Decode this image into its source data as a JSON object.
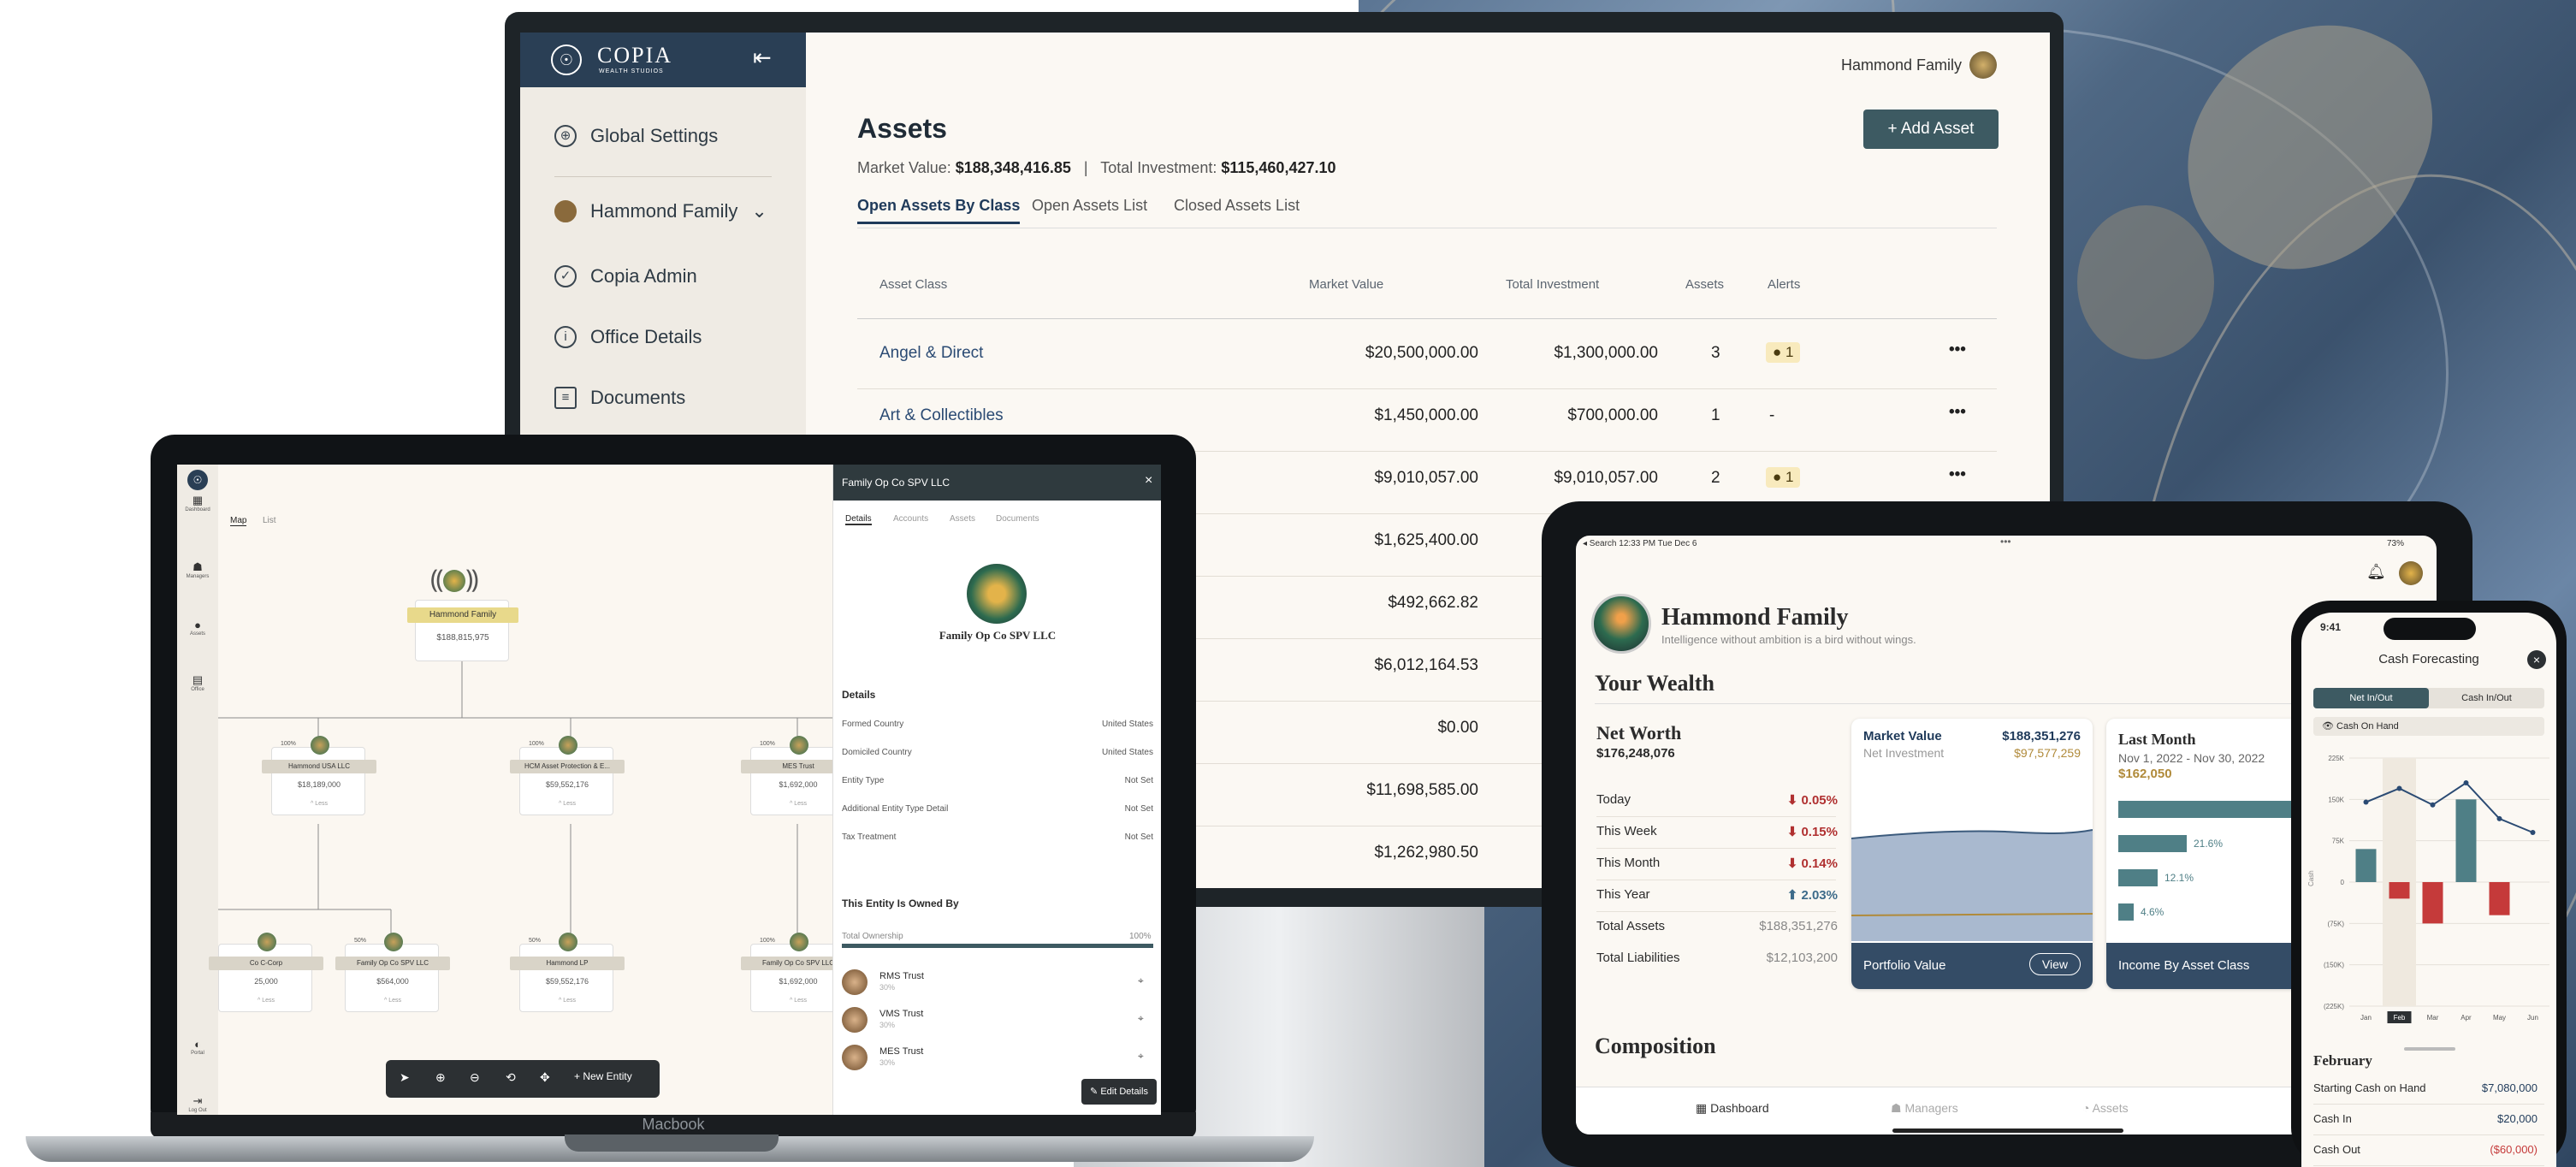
{
  "monitor": {
    "brand": "COPIA",
    "brand_sub": "WEALTH STUDIOS",
    "account_label": "Hammond Family",
    "nav": [
      "Global Settings",
      "Hammond Family",
      "Copia Admin",
      "Office Details",
      "Documents"
    ],
    "title": "Assets",
    "add_button": "+ Add Asset",
    "market_value_label": "Market Value:",
    "market_value": "$188,348,416.85",
    "separator": "|",
    "total_investment_label": "Total Investment:",
    "total_investment": "$115,460,427.10",
    "tabs": [
      "Open Assets By Class",
      "Open Assets List",
      "Closed Assets List"
    ],
    "columns": [
      "Asset Class",
      "Market Value",
      "Total Investment",
      "Assets",
      "Alerts"
    ],
    "rows": [
      {
        "name": "Angel & Direct",
        "mv": "$20,500,000.00",
        "ti": "$1,300,000.00",
        "count": "3",
        "alert": "1"
      },
      {
        "name": "Art & Collectibles",
        "mv": "$1,450,000.00",
        "ti": "$700,000.00",
        "count": "1",
        "alert": "-"
      },
      {
        "name": "",
        "mv": "$9,010,057.00",
        "ti": "$9,010,057.00",
        "count": "2",
        "alert": "1"
      },
      {
        "name": "",
        "mv": "$1,625,400.00",
        "ti": "$1,11"
      },
      {
        "name": "",
        "mv": "$492,662.82",
        "ti": "$"
      },
      {
        "name": "",
        "mv": "$6,012,164.53",
        "ti": "$2,30"
      },
      {
        "name": "",
        "mv": "$0.00",
        "ti": "$"
      },
      {
        "name": "",
        "mv": "$11,698,585.00",
        "ti": "$10,00"
      },
      {
        "name": "",
        "mv": "$1,262,980.50",
        "ti": "$1,03"
      }
    ],
    "more": "•••"
  },
  "laptop": {
    "brand_label": "Macbook",
    "sidebar": [
      "Dashboard",
      "Managers",
      "Assets",
      "Office",
      "Portal",
      "Log Out"
    ],
    "view_tabs": [
      "Map",
      "List"
    ],
    "root_name": "Hammond Family",
    "root_value": "$188,815,975",
    "nodes": [
      {
        "pct": "100%",
        "name": "Hammond USA LLC",
        "value": "$18,189,000"
      },
      {
        "pct": "100%",
        "name": "HCM Asset Protection & E...",
        "value": "$59,552,176"
      },
      {
        "pct": "100%",
        "name": "MES Trust",
        "value": "$1,692,000"
      },
      {
        "pct": "",
        "name": "Co C-Corp",
        "value": "25,000"
      },
      {
        "pct": "50%",
        "name": "Family Op Co SPV LLC",
        "value": "$564,000"
      },
      {
        "pct": "50%",
        "name": "Hammond LP",
        "value": "$59,552,176"
      },
      {
        "pct": "100%",
        "name": "Family Op Co SPV LLC",
        "value": "$1,692,000"
      }
    ],
    "node_footer": "^ Less",
    "toolbar_new": "+ New Entity",
    "panel": {
      "title": "Family Op Co SPV LLC",
      "close": "×",
      "tabs": [
        "Details",
        "Accounts",
        "Assets",
        "Documents"
      ],
      "entity_name": "Family Op Co SPV LLC",
      "section": "Details",
      "fields": [
        {
          "k": "Formed Country",
          "v": "United States"
        },
        {
          "k": "Domiciled Country",
          "v": "United States"
        },
        {
          "k": "Entity Type",
          "v": "Not Set"
        },
        {
          "k": "Additional Entity Type Detail",
          "v": "Not Set"
        },
        {
          "k": "Tax Treatment",
          "v": "Not Set"
        }
      ],
      "owned_title": "This Entity Is Owned By",
      "total_label": "Total Ownership",
      "total_value": "100%",
      "owners": [
        {
          "n": "RMS Trust",
          "p": "30%"
        },
        {
          "n": "VMS Trust",
          "p": "30%"
        },
        {
          "n": "MES Trust",
          "p": "30%"
        }
      ],
      "edit": "Edit Details"
    }
  },
  "tablet": {
    "status_left": "◂ Search  12:33 PM  Tue Dec 6",
    "status_right": "73%",
    "family": "Hammond Family",
    "quote": "Intelligence without ambition is a bird without wings.",
    "your_wealth": "Your Wealth",
    "net_worth_label": "Net Worth",
    "net_worth": "$176,248,076",
    "periods": [
      {
        "k": "Today",
        "v": "0.05%",
        "dir": "down"
      },
      {
        "k": "This Week",
        "v": "0.15%",
        "dir": "down"
      },
      {
        "k": "This Month",
        "v": "0.14%",
        "dir": "down"
      },
      {
        "k": "This Year",
        "v": "2.03%",
        "dir": "up"
      }
    ],
    "totals": [
      {
        "k": "Total Assets",
        "v": "$188,351,276"
      },
      {
        "k": "Total Liabilities",
        "v": "$12,103,200"
      }
    ],
    "mv_label": "Market Value",
    "mv_value": "$188,351,276",
    "ni_label": "Net Investment",
    "ni_value": "$97,577,259",
    "portfolio_label": "Portfolio Value",
    "view": "View",
    "last_month": "Last Month",
    "range": "Nov 1, 2022 - Nov 30, 2022",
    "lm_value": "$162,050",
    "income_label": "Income By Asset Class",
    "bars": [
      "61",
      "21.6%",
      "12.1%",
      "4.6%"
    ],
    "composition": "Composition",
    "tabbar": [
      "Dashboard",
      "Managers",
      "Assets"
    ]
  },
  "phone": {
    "time": "9:41",
    "title": "Cash Forecasting",
    "seg": [
      "Net In/Out",
      "Cash In/Out"
    ],
    "toggle": "Cash On Hand",
    "yticks": [
      "225K",
      "150K",
      "75K",
      "0",
      "(75K)",
      "(150K)",
      "(225K)"
    ],
    "ylabel": "Cash",
    "months": [
      "Jan",
      "Feb",
      "Mar",
      "Apr",
      "May",
      "Jun"
    ],
    "month_title": "February",
    "rows": [
      {
        "k": "Starting Cash on Hand",
        "v": "$7,080,000"
      },
      {
        "k": "Cash In",
        "v": "$20,000"
      },
      {
        "k": "Cash Out",
        "v": "($60,000)"
      }
    ]
  },
  "chart_data": {
    "type": "bar",
    "categories": [
      "Jan",
      "Feb",
      "Mar",
      "Apr",
      "May",
      "Jun"
    ],
    "series": [
      {
        "name": "Net In/Out",
        "values": [
          60000,
          -30000,
          -75000,
          150000,
          -60000,
          0
        ]
      },
      {
        "name": "Cash On Hand",
        "values": [
          145000,
          170000,
          140000,
          180000,
          115000,
          90000
        ]
      }
    ],
    "ylim": [
      -225000,
      225000
    ],
    "ylabel": "Cash"
  }
}
